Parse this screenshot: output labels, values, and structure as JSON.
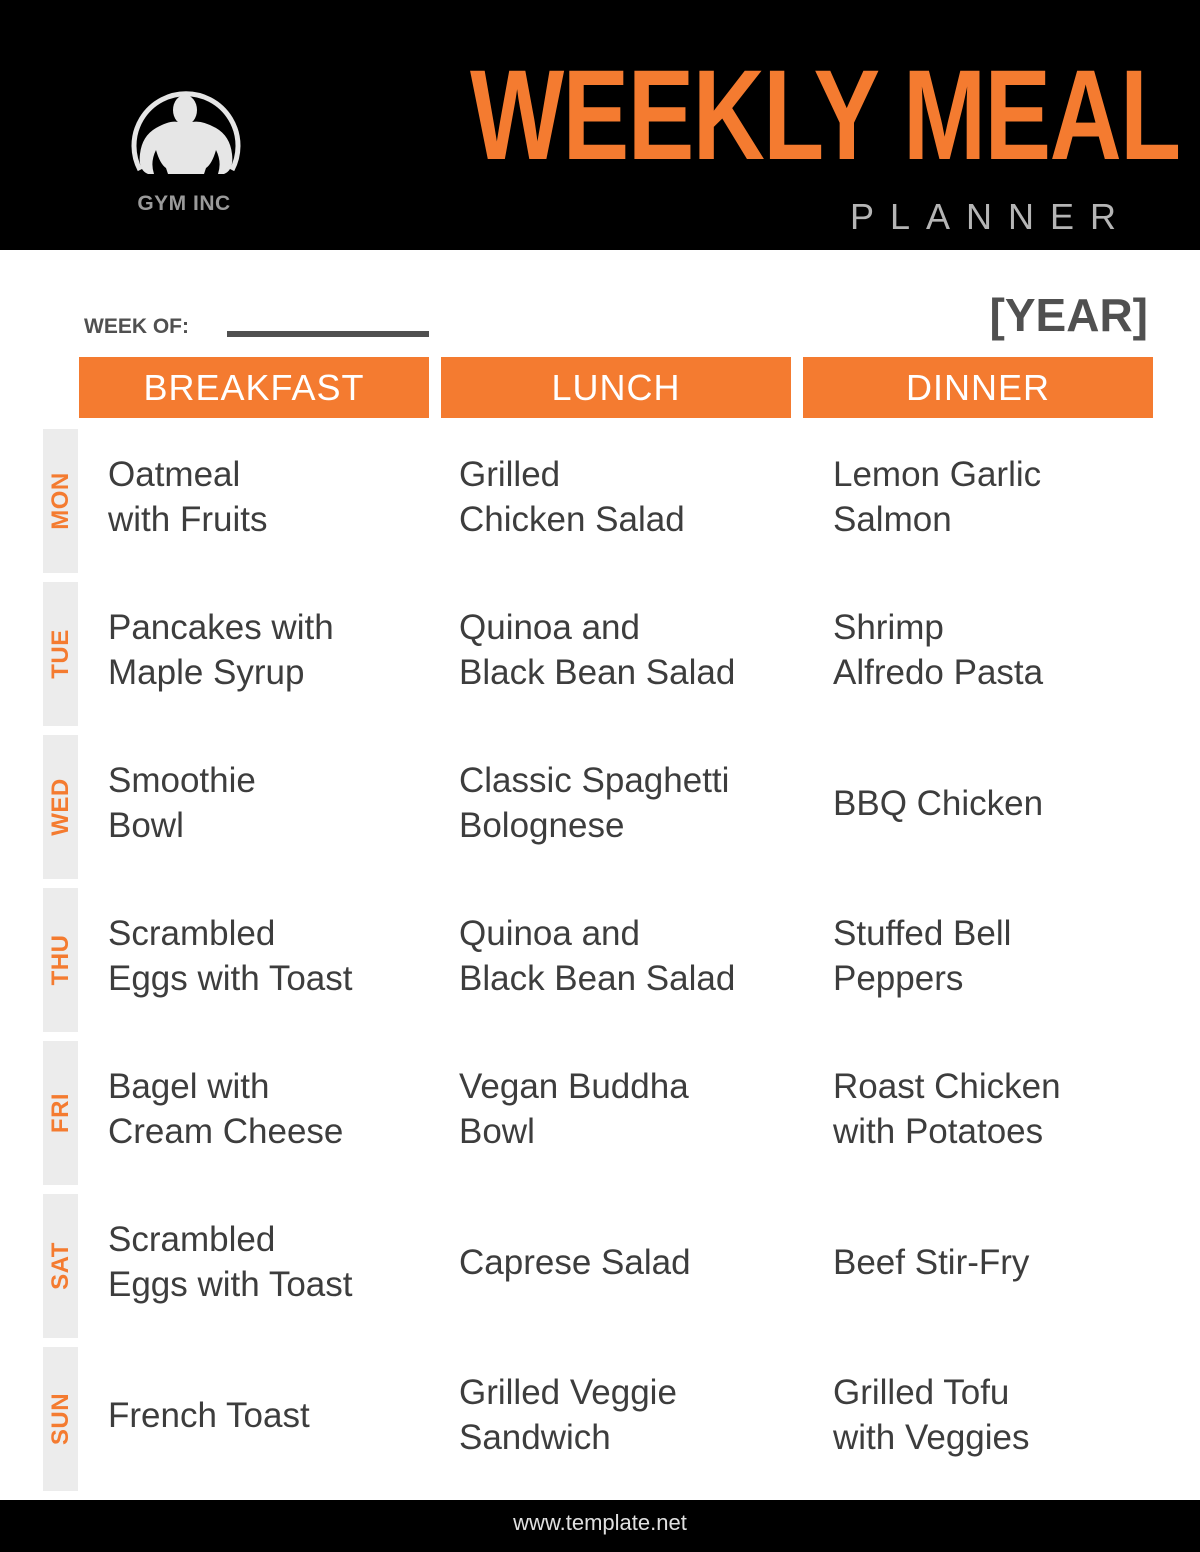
{
  "header": {
    "brand": "GYM INC",
    "brand_icon": "bodybuilder-icon",
    "title": "WEEKLY MEAL",
    "subtitle": "PLANNER",
    "accent_color": "#f47b30"
  },
  "week": {
    "label": "WEEK OF:",
    "value": "",
    "year": "[YEAR]"
  },
  "columns": [
    "BREAKFAST",
    "LUNCH",
    "DINNER"
  ],
  "days": [
    {
      "day": "MON",
      "breakfast": [
        "Oatmeal",
        "with Fruits"
      ],
      "lunch": [
        "Grilled",
        "Chicken Salad"
      ],
      "dinner": [
        "Lemon Garlic",
        "Salmon"
      ]
    },
    {
      "day": "TUE",
      "breakfast": [
        "Pancakes with",
        "Maple Syrup"
      ],
      "lunch": [
        "Quinoa and",
        "Black Bean Salad"
      ],
      "dinner": [
        "Shrimp",
        "Alfredo Pasta"
      ]
    },
    {
      "day": "WED",
      "breakfast": [
        "Smoothie",
        "Bowl"
      ],
      "lunch": [
        "Classic Spaghetti",
        "Bolognese"
      ],
      "dinner": [
        "BBQ Chicken"
      ]
    },
    {
      "day": "THU",
      "breakfast": [
        "Scrambled",
        "Eggs with Toast"
      ],
      "lunch": [
        "Quinoa and",
        "Black Bean Salad"
      ],
      "dinner": [
        "Stuffed Bell",
        "Peppers"
      ]
    },
    {
      "day": "FRI",
      "breakfast": [
        "Bagel with",
        "Cream Cheese"
      ],
      "lunch": [
        "Vegan Buddha",
        "Bowl"
      ],
      "dinner": [
        "Roast Chicken",
        "with Potatoes"
      ]
    },
    {
      "day": "SAT",
      "breakfast": [
        "Scrambled",
        "Eggs with Toast"
      ],
      "lunch": [
        "Caprese Salad"
      ],
      "dinner": [
        "Beef Stir-Fry"
      ]
    },
    {
      "day": "SUN",
      "breakfast": [
        "French Toast"
      ],
      "lunch": [
        "Grilled Veggie",
        "Sandwich"
      ],
      "dinner": [
        "Grilled Tofu",
        "with Veggies"
      ]
    }
  ],
  "footer": {
    "url": "www.template.net"
  }
}
